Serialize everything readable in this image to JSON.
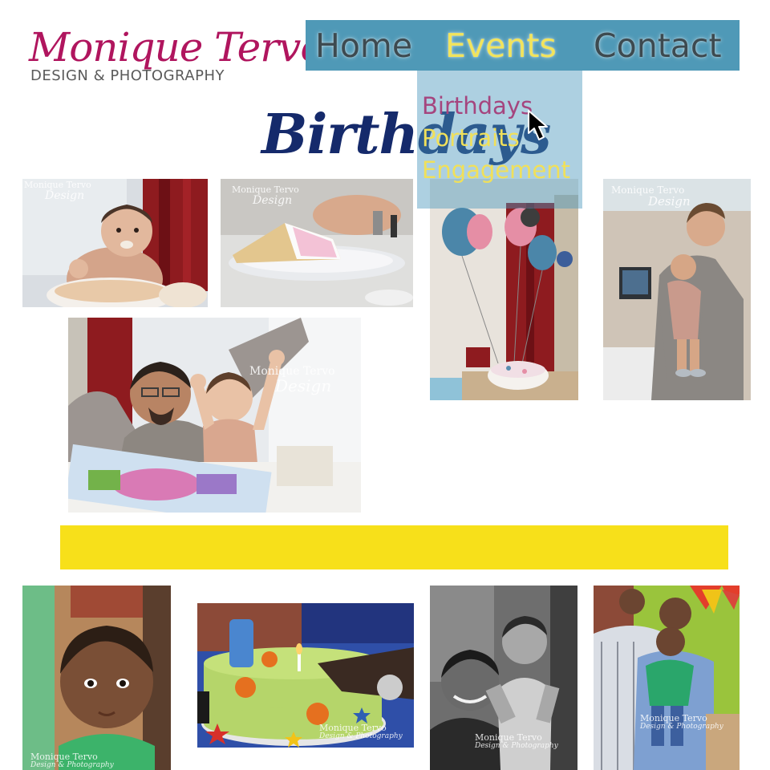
{
  "logo": {
    "name": "Monique Tervo",
    "tagline": "DESIGN & PHOTOGRAPHY",
    "name_color": "#b0155e"
  },
  "nav": {
    "items": [
      {
        "label": "Home",
        "color": "#3d4a50"
      },
      {
        "label": "Events",
        "color": "#f2e45c"
      },
      {
        "label": "Contact",
        "color": "#3d4a50"
      }
    ],
    "background": "#4f99b7"
  },
  "dropdown": {
    "items": [
      {
        "label": "Birthdays",
        "color": "#a5457e"
      },
      {
        "label": "Portraits",
        "color": "#f0e05a"
      },
      {
        "label": "Engagement",
        "color": "#f0e05a"
      }
    ]
  },
  "page": {
    "title": "Birthdays",
    "title_color": "#152a6b"
  },
  "watermarks": {
    "short_line1": "Monique Tervo",
    "short_line2": "Design",
    "long_line1": "Monique Tervo",
    "long_line2": "Design & Photography"
  },
  "banner": {
    "color": "#f7e01a"
  },
  "cursor_icon": "arrow-pointer-icon"
}
